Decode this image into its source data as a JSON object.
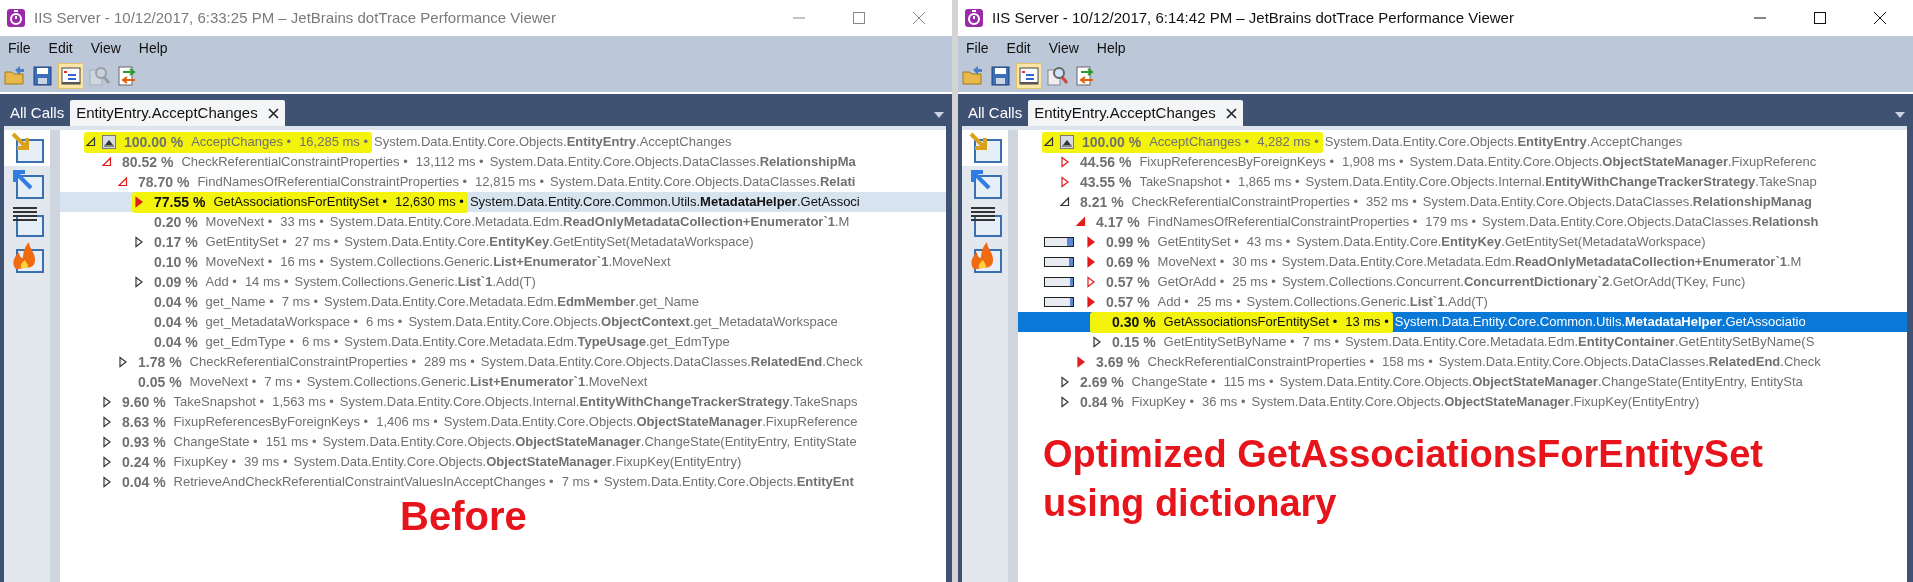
{
  "windows": [
    {
      "title": "IIS Server - 10/12/2017, 6:33:25 PM – JetBrains dotTrace Performance Viewer",
      "active": false,
      "menu": [
        "File",
        "Edit",
        "View",
        "Help"
      ],
      "toolbar": [
        {
          "kind": "open",
          "pressed": false,
          "disabled": false
        },
        {
          "kind": "save",
          "pressed": false,
          "disabled": false
        },
        {
          "kind": "tree",
          "pressed": true,
          "disabled": false
        },
        {
          "kind": "search",
          "pressed": false,
          "disabled": true
        },
        {
          "kind": "compare",
          "pressed": false,
          "disabled": false
        }
      ],
      "tabs": [
        {
          "label": "All Calls",
          "selected": false,
          "closable": false
        },
        {
          "label": "EntityEntry.AcceptChanges",
          "selected": true,
          "closable": true
        }
      ],
      "views": [
        {
          "kind": "callees",
          "selected": true
        },
        {
          "kind": "callers",
          "selected": false
        },
        {
          "kind": "list",
          "selected": false
        },
        {
          "kind": "hotspots",
          "selected": false
        }
      ],
      "tree": [
        {
          "root": true,
          "expandable": true,
          "expanded": true,
          "hot": false,
          "marked": true,
          "selected": false,
          "percent": "100.00 %",
          "name": "AcceptChanges •",
          "time": "16,285 ms •",
          "method": "System.Data.Entity.Core.Objects.**EntityEntry**.AcceptChanges",
          "children": [
            {
              "expandable": true,
              "expanded": true,
              "hot": true,
              "filled": false,
              "marked": false,
              "selected": false,
              "percent": "80.52 %",
              "name": "CheckReferentialConstraintProperties •",
              "time": "13,112 ms •",
              "method": "System.Data.Entity.Core.Objects.DataClasses.**RelationshipMa**",
              "children": [
                {
                  "expandable": true,
                  "expanded": true,
                  "hot": true,
                  "filled": false,
                  "marked": false,
                  "selected": false,
                  "percent": "78.70 %",
                  "name": "FindNamesOfReferentialConstraintProperties •",
                  "time": "12,815 ms •",
                  "method": "System.Data.Entity.Core.Objects.DataClasses.**Relati**",
                  "children": [
                    {
                      "expandable": true,
                      "expanded": false,
                      "hot": true,
                      "filled": true,
                      "marked": true,
                      "selected": true,
                      "percent": "77.55 %",
                      "name": "GetAssociationsForEntitySet •",
                      "time": "12,630 ms •",
                      "method": "System.Data.Entity.Core.Common.Utils.**MetadataHelper**.GetAssoci"
                    },
                    {
                      "expandable": false,
                      "marked": false,
                      "selected": false,
                      "percent": "0.20 %",
                      "name": "MoveNext •",
                      "time": "33 ms •",
                      "method": "System.Data.Entity.Core.Metadata.Edm.**ReadOnlyMetadataCollection+Enumerator`1**.M"
                    },
                    {
                      "expandable": true,
                      "expanded": false,
                      "hot": false,
                      "marked": false,
                      "selected": false,
                      "percent": "0.17 %",
                      "name": "GetEntitySet •",
                      "time": "27 ms •",
                      "method": "System.Data.Entity.Core.**EntityKey**.GetEntitySet(MetadataWorkspace)"
                    },
                    {
                      "expandable": false,
                      "marked": false,
                      "selected": false,
                      "percent": "0.10 %",
                      "name": "MoveNext •",
                      "time": "16 ms •",
                      "method": "System.Collections.Generic.**List+Enumerator`1**.MoveNext"
                    },
                    {
                      "expandable": true,
                      "expanded": false,
                      "hot": false,
                      "marked": false,
                      "selected": false,
                      "percent": "0.09 %",
                      "name": "Add •",
                      "time": "14 ms •",
                      "method": "System.Collections.Generic.**List`1**.Add(T)"
                    },
                    {
                      "expandable": false,
                      "marked": false,
                      "selected": false,
                      "percent": "0.04 %",
                      "name": "get_Name •",
                      "time": "7 ms •",
                      "method": "System.Data.Entity.Core.Metadata.Edm.**EdmMember**.get_Name"
                    },
                    {
                      "expandable": false,
                      "marked": false,
                      "selected": false,
                      "percent": "0.04 %",
                      "name": "get_MetadataWorkspace •",
                      "time": "6 ms •",
                      "method": "System.Data.Entity.Core.Objects.**ObjectContext**.get_MetadataWorkspace"
                    },
                    {
                      "expandable": false,
                      "marked": false,
                      "selected": false,
                      "percent": "0.04 %",
                      "name": "get_EdmType •",
                      "time": "6 ms •",
                      "method": "System.Data.Entity.Core.Metadata.Edm.**TypeUsage**.get_EdmType"
                    }
                  ]
                },
                {
                  "expandable": true,
                  "expanded": false,
                  "hot": false,
                  "marked": false,
                  "selected": false,
                  "percent": "1.78 %",
                  "name": "CheckReferentialConstraintProperties •",
                  "time": "289 ms •",
                  "method": "System.Data.Entity.Core.Objects.DataClasses.**RelatedEnd**.Check"
                },
                {
                  "expandable": false,
                  "marked": false,
                  "selected": false,
                  "percent": "0.05 %",
                  "name": "MoveNext •",
                  "time": "7 ms •",
                  "method": "System.Collections.Generic.**List+Enumerator`1**.MoveNext"
                }
              ]
            },
            {
              "expandable": true,
              "expanded": false,
              "hot": false,
              "marked": false,
              "selected": false,
              "percent": "9.60 %",
              "name": "TakeSnapshot •",
              "time": "1,563 ms •",
              "method": "System.Data.Entity.Core.Objects.Internal.**EntityWithChangeTrackerStrategy**.TakeSnaps"
            },
            {
              "expandable": true,
              "expanded": false,
              "hot": false,
              "marked": false,
              "selected": false,
              "percent": "8.63 %",
              "name": "FixupReferencesByForeignKeys •",
              "time": "1,406 ms •",
              "method": "System.Data.Entity.Core.Objects.**ObjectStateManager**.FixupReference"
            },
            {
              "expandable": true,
              "expanded": false,
              "hot": false,
              "marked": false,
              "selected": false,
              "percent": "0.93 %",
              "name": "ChangeState •",
              "time": "151 ms •",
              "method": "System.Data.Entity.Core.Objects.**ObjectStateManager**.ChangeState(EntityEntry, EntityState"
            },
            {
              "expandable": true,
              "expanded": false,
              "hot": false,
              "marked": false,
              "selected": false,
              "percent": "0.24 %",
              "name": "FixupKey •",
              "time": "39 ms •",
              "method": "System.Data.Entity.Core.Objects.**ObjectStateManager**.FixupKey(EntityEntry)"
            },
            {
              "expandable": true,
              "expanded": false,
              "hot": false,
              "marked": false,
              "selected": false,
              "percent": "0.04 %",
              "name": "RetrieveAndCheckReferentialConstraintValuesInAcceptChanges •",
              "time": "7 ms •",
              "method": "System.Data.Entity.Core.Objects.**EntityEnt**"
            }
          ]
        }
      ],
      "annotation": [
        "Before"
      ]
    },
    {
      "title": "IIS Server - 10/12/2017, 6:14:42 PM – JetBrains dotTrace Performance Viewer",
      "active": true,
      "menu": [
        "File",
        "Edit",
        "View",
        "Help"
      ],
      "toolbar": [
        {
          "kind": "open",
          "pressed": false,
          "disabled": false
        },
        {
          "kind": "save",
          "pressed": false,
          "disabled": false
        },
        {
          "kind": "tree",
          "pressed": true,
          "disabled": false
        },
        {
          "kind": "search",
          "pressed": false,
          "disabled": false
        },
        {
          "kind": "compare",
          "pressed": false,
          "disabled": false
        }
      ],
      "tabs": [
        {
          "label": "All Calls",
          "selected": false,
          "closable": false
        },
        {
          "label": "EntityEntry.AcceptChanges",
          "selected": true,
          "closable": true
        }
      ],
      "views": [
        {
          "kind": "callees",
          "selected": true
        },
        {
          "kind": "callers",
          "selected": false
        },
        {
          "kind": "list",
          "selected": false
        },
        {
          "kind": "hotspots",
          "selected": false
        }
      ],
      "tree": [
        {
          "root": true,
          "expandable": true,
          "expanded": true,
          "hot": false,
          "marked": true,
          "selected": false,
          "percent": "100.00 %",
          "name": "AcceptChanges •",
          "time": "4,282 ms •",
          "method": "System.Data.Entity.Core.Objects.**EntityEntry**.AcceptChanges",
          "children": [
            {
              "expandable": true,
              "expanded": false,
              "hot": true,
              "filled": false,
              "marked": false,
              "selected": false,
              "percent": "44.56 %",
              "name": "FixupReferencesByForeignKeys •",
              "time": "1,908 ms •",
              "method": "System.Data.Entity.Core.Objects.**ObjectStateManager**.FixupReferenc"
            },
            {
              "expandable": true,
              "expanded": false,
              "hot": true,
              "filled": false,
              "marked": false,
              "selected": false,
              "percent": "43.55 %",
              "name": "TakeSnapshot •",
              "time": "1,865 ms •",
              "method": "System.Data.Entity.Core.Objects.Internal.**EntityWithChangeTrackerStrategy**.TakeSnap"
            },
            {
              "expandable": true,
              "expanded": true,
              "hot": false,
              "marked": false,
              "selected": false,
              "percent": "8.21 %",
              "name": "CheckReferentialConstraintProperties •",
              "time": "352 ms •",
              "method": "System.Data.Entity.Core.Objects.DataClasses.**RelationshipManag**",
              "children": [
                {
                  "expandable": true,
                  "expanded": true,
                  "hot": true,
                  "filled": true,
                  "marked": false,
                  "selected": false,
                  "percent": "4.17 %",
                  "name": "FindNamesOfReferentialConstraintProperties •",
                  "time": "179 ms •",
                  "method": "System.Data.Entity.Core.Objects.DataClasses.**Relationsh**",
                  "children": [
                    {
                      "expandable": true,
                      "expanded": false,
                      "hot": true,
                      "filled": true,
                      "marked": false,
                      "selected": false,
                      "level": 0.2,
                      "percent": "0.99 %",
                      "name": "GetEntitySet •",
                      "time": "43 ms •",
                      "method": "System.Data.Entity.Core.**EntityKey**.GetEntitySet(MetadataWorkspace)"
                    },
                    {
                      "expandable": true,
                      "expanded": false,
                      "hot": true,
                      "filled": true,
                      "marked": false,
                      "selected": false,
                      "level": 0.15,
                      "percent": "0.69 %",
                      "name": "MoveNext •",
                      "time": "30 ms •",
                      "method": "System.Data.Entity.Core.Metadata.Edm.**ReadOnlyMetadataCollection+Enumerator`1**.M"
                    },
                    {
                      "expandable": true,
                      "expanded": false,
                      "hot": true,
                      "filled": false,
                      "marked": false,
                      "selected": false,
                      "level": 0.12,
                      "percent": "0.57 %",
                      "name": "GetOrAdd •",
                      "time": "25 ms •",
                      "method": "System.Collections.Concurrent.**ConcurrentDictionary`2**.GetOrAdd(TKey, Func)"
                    },
                    {
                      "expandable": true,
                      "expanded": false,
                      "hot": true,
                      "filled": true,
                      "marked": false,
                      "selected": false,
                      "level": 0.12,
                      "percent": "0.57 %",
                      "name": "Add •",
                      "time": "25 ms •",
                      "method": "System.Collections.Generic.**List`1**.Add(T)"
                    },
                    {
                      "expandable": false,
                      "marked": true,
                      "selected": true,
                      "percent": "0.30 %",
                      "name": "GetAssociationsForEntitySet •",
                      "time": "13 ms •",
                      "method": "System.Data.Entity.Core.Common.Utils.**MetadataHelper**.GetAssociatio"
                    },
                    {
                      "expandable": true,
                      "expanded": false,
                      "hot": false,
                      "marked": false,
                      "selected": false,
                      "percent": "0.15 %",
                      "name": "GetEntitySetByName •",
                      "time": "7 ms •",
                      "method": "System.Data.Entity.Core.Metadata.Edm.**EntityContainer**.GetEntitySetByName(S"
                    }
                  ]
                },
                {
                  "expandable": true,
                  "expanded": false,
                  "hot": true,
                  "filled": true,
                  "marked": false,
                  "selected": false,
                  "percent": "3.69 %",
                  "name": "CheckReferentialConstraintProperties •",
                  "time": "158 ms •",
                  "method": "System.Data.Entity.Core.Objects.DataClasses.**RelatedEnd**.Check"
                }
              ]
            },
            {
              "expandable": true,
              "expanded": false,
              "hot": false,
              "marked": false,
              "selected": false,
              "percent": "2.69 %",
              "name": "ChangeState •",
              "time": "115 ms •",
              "method": "System.Data.Entity.Core.Objects.**ObjectStateManager**.ChangeState(EntityEntry, EntitySta"
            },
            {
              "expandable": true,
              "expanded": false,
              "hot": false,
              "marked": false,
              "selected": false,
              "percent": "0.84 %",
              "name": "FixupKey •",
              "time": "36 ms •",
              "method": "System.Data.Entity.Core.Objects.**ObjectStateManager**.FixupKey(EntityEntry)"
            }
          ]
        }
      ],
      "annotation": [
        "Optimized GetAssociationsForEntitySet",
        "using dictionary"
      ]
    }
  ]
}
